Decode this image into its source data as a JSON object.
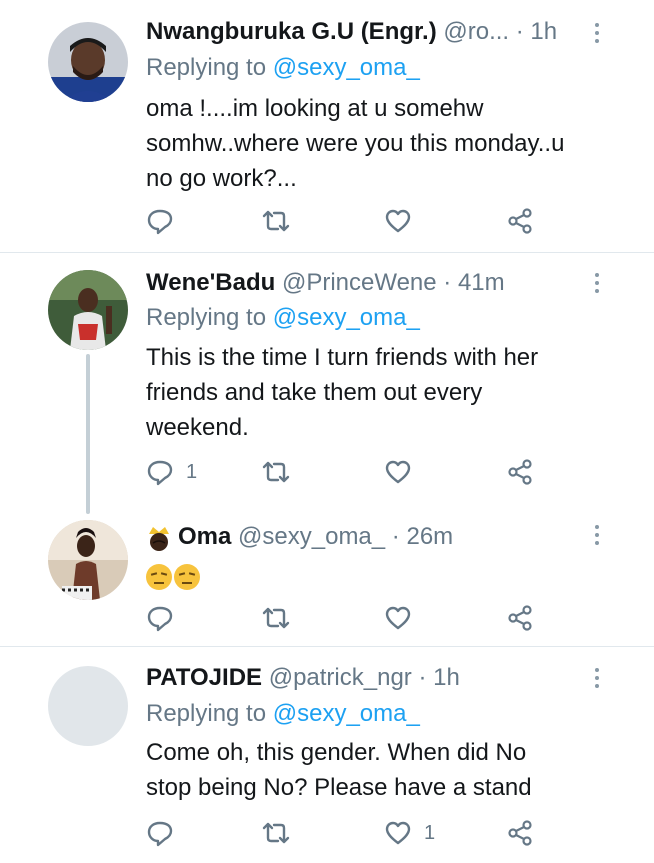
{
  "tweets": [
    {
      "name": "Nwangburuka G.U (Engr.)",
      "handle": "@ro...",
      "dot": "·",
      "time": "1h",
      "replying_label": "Replying to",
      "replying_to": "@sexy_oma_",
      "text_lines": [
        "oma !....im looking at u somehw",
        "somhw..where were you this monday..u",
        "no go work?..."
      ],
      "reply_count": "",
      "retweet_count": "",
      "like_count": ""
    },
    {
      "name": "Wene'Badu",
      "handle": "@PrinceWene",
      "dot": "·",
      "time": "41m",
      "replying_label": "Replying to",
      "replying_to": "@sexy_oma_",
      "text_lines": [
        "This is the time I turn friends with her",
        "friends and take them out every",
        "weekend."
      ],
      "reply_count": "1",
      "retweet_count": "",
      "like_count": ""
    },
    {
      "name": "Oma",
      "handle": "@sexy_oma_",
      "dot": "·",
      "time": "26m",
      "name_emoji": "crown-emoji-icon",
      "text_emojis": [
        "unamused-face-icon",
        "unamused-face-icon"
      ],
      "reply_count": "",
      "retweet_count": "",
      "like_count": ""
    },
    {
      "name": "PATOJIDE",
      "handle": "@patrick_ngr",
      "dot": "·",
      "time": "1h",
      "replying_label": "Replying to",
      "replying_to": "@sexy_oma_",
      "text_lines": [
        "Come oh, this gender. When did No",
        "stop being No? Please have a stand"
      ],
      "reply_count": "",
      "retweet_count": "",
      "like_count": "1"
    }
  ],
  "colors": {
    "text": "#14171a",
    "secondary": "#657786",
    "mention": "#1da1f2",
    "divider": "#e1e8ed"
  },
  "icons": [
    "reply-icon",
    "retweet-icon",
    "like-icon",
    "share-icon",
    "more-options-icon"
  ]
}
